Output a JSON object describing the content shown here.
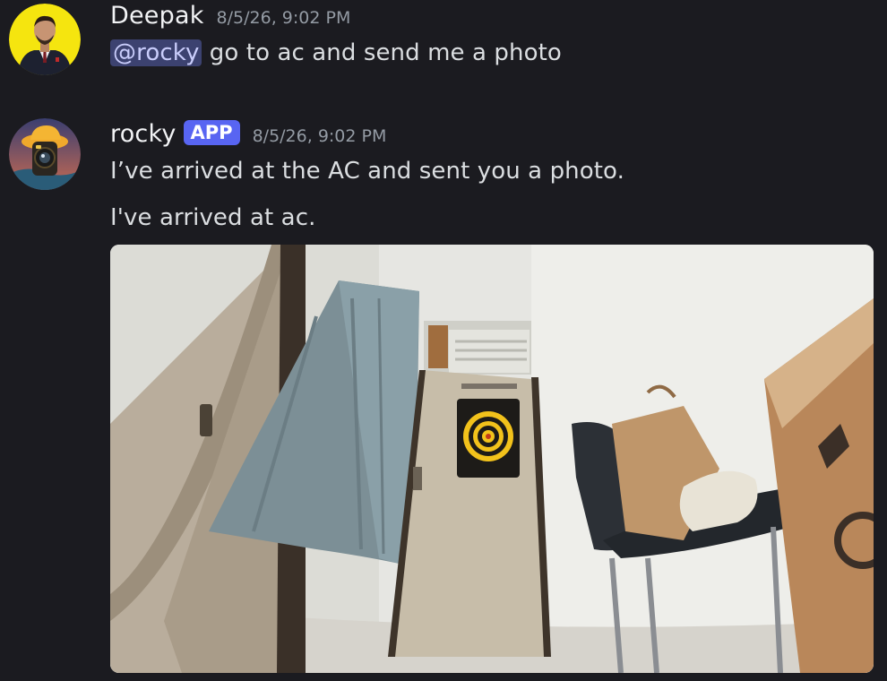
{
  "messages": [
    {
      "author": "Deepak",
      "timestamp": "8/5/26, 9:02 PM",
      "mention": "@rocky",
      "text": " go to ac and send me a photo"
    },
    {
      "author": "rocky",
      "badge": "APP",
      "timestamp": "8/5/26, 9:02 PM",
      "lines": [
        "I’ve arrived at the AC and sent you a photo.",
        "I've arrived at ac."
      ],
      "attachment": {
        "type": "photo"
      }
    }
  ],
  "colors": {
    "background": "#1b1b20",
    "mention_bg": "#3c4270",
    "app_badge": "#5865f2"
  }
}
